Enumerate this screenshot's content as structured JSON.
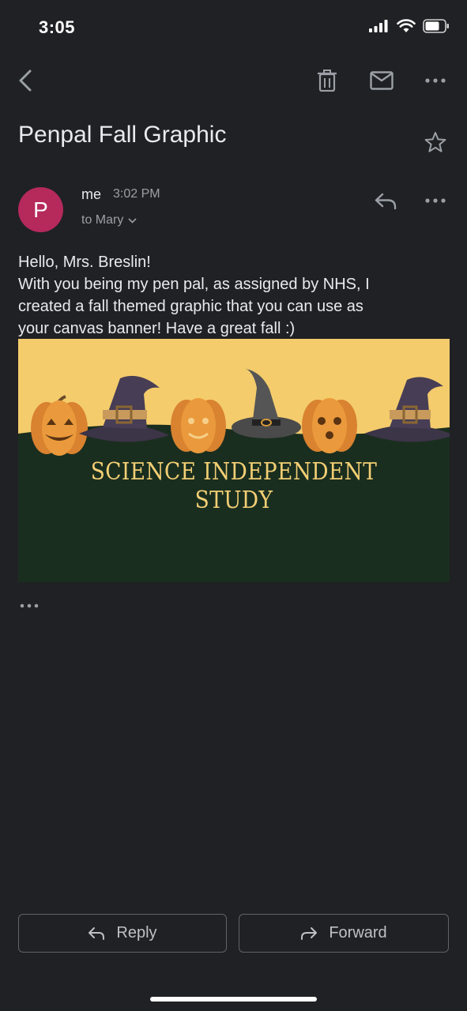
{
  "status_bar": {
    "time": "3:05"
  },
  "toolbar": {
    "back_icon": "back-arrow-icon",
    "delete_icon": "trash-icon",
    "mark_unread_icon": "mail-icon",
    "more_icon": "more-horiz-icon"
  },
  "email": {
    "subject": "Penpal Fall Graphic",
    "sender": {
      "avatar_letter": "P",
      "avatar_color": "#b5295b",
      "name": "me",
      "time": "3:02 PM",
      "recipient_line": "to Mary"
    },
    "body_lines": [
      "Hello, Mrs. Breslin!",
      "With you being my pen pal, as assigned by NHS, I",
      "created a fall themed graphic that you can use as",
      "your canvas banner! Have a great fall :)"
    ],
    "banner": {
      "title_line1": "SCIENCE INDEPENDENT",
      "title_line2": "STUDY",
      "colors": {
        "sky": "#f4cc6c",
        "ground": "#1a2e1f",
        "pumpkin": "#e8993a",
        "hat": "#3c3447",
        "text": "#f3cf74"
      }
    }
  },
  "actions": {
    "reply_label": "Reply",
    "forward_label": "Forward"
  }
}
